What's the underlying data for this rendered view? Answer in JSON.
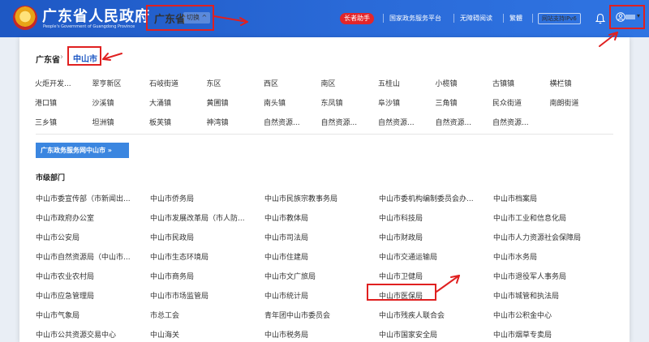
{
  "header": {
    "site_title": "广东省人民政府",
    "site_subtitle": "People's Government of Guangdong Province",
    "region": "广东省",
    "switch_label": "切换 ^",
    "elder_mode": "长者助手",
    "links": [
      "国家政务服务平台",
      "无障碍阅读",
      "繁體"
    ],
    "ipv6": "网站支持IPv6"
  },
  "breadcrumb": {
    "root": "广东省",
    "separator": "›",
    "current": "中山市"
  },
  "towns": [
    [
      "火炬开发...",
      "翠亨新区",
      "石岐街道",
      "东区",
      "西区",
      "南区",
      "五桂山",
      "小榄镇",
      "古镇镇",
      "横栏镇"
    ],
    [
      "港口镇",
      "沙溪镇",
      "大涌镇",
      "黄圃镇",
      "南头镇",
      "东凤镇",
      "阜沙镇",
      "三角镇",
      "民众街道",
      "南朗街道"
    ],
    [
      "三乡镇",
      "坦洲镇",
      "板芙镇",
      "神湾镇",
      "自然资源...",
      "自然资源...",
      "自然资源...",
      "自然资源...",
      "自然资源...",
      ""
    ]
  ],
  "service_banner": "广东政务服务网中山市 »",
  "section_title": "市级部门",
  "departments": [
    [
      "中山市委宣传部（市新闻出...",
      "中山市侨务局",
      "中山市民族宗教事务局",
      "中山市委机构编制委员会办...",
      "中山市档案局"
    ],
    [
      "中山市政府办公室",
      "中山市发展改革局（市人防...",
      "中山市教体局",
      "中山市科技局",
      "中山市工业和信息化局"
    ],
    [
      "中山市公安局",
      "中山市民政局",
      "中山市司法局",
      "中山市财政局",
      "中山市人力资源社会保障局"
    ],
    [
      "中山市自然资源局（中山市...",
      "中山市生态环境局",
      "中山市住建局",
      "中山市交通运输局",
      "中山市水务局"
    ],
    [
      "中山市农业农村局",
      "中山市商务局",
      "中山市文广旅局",
      "中山市卫健局",
      "中山市退役军人事务局"
    ],
    [
      "中山市应急管理局",
      "中山市市场监管局",
      "中山市统计局",
      "中山市医保局",
      "中山市城管和执法局"
    ],
    [
      "中山市气象局",
      "市总工会",
      "青年团中山市委员会",
      "中山市残疾人联合会",
      "中山市公积金中心"
    ],
    [
      "中山市公共资源交易中心",
      "中山海关",
      "中山市税务局",
      "中山市国家安全局",
      "中山市烟草专卖局"
    ]
  ],
  "colors": {
    "header_blue": "#1e58c4",
    "annotation_red": "#e02020",
    "banner_blue": "#3b86e0"
  },
  "icons": {
    "emblem": "national-emblem-icon",
    "bell": "bell-icon",
    "user": "user-icon"
  }
}
